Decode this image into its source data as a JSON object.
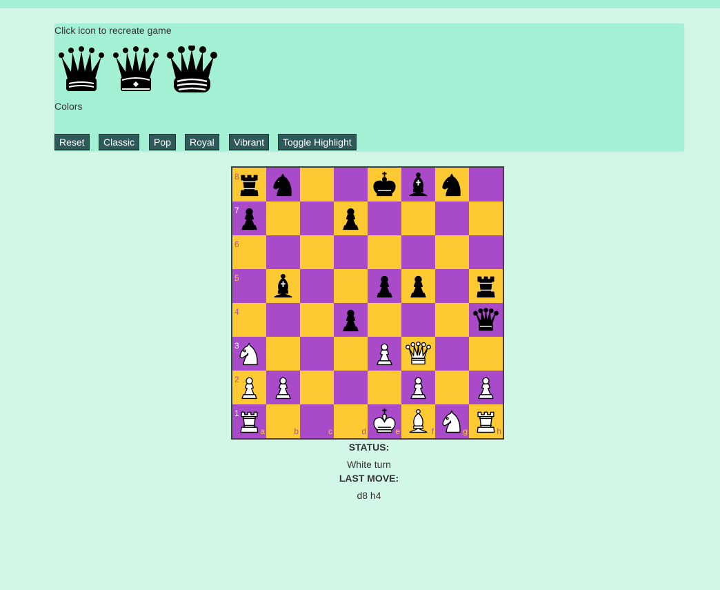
{
  "panel": {
    "title": "Click icon to recreate game",
    "colors_label": "Colors",
    "icons": [
      "queen-icon",
      "queen-icon",
      "queen-icon"
    ],
    "buttons": [
      "Reset",
      "Classic",
      "Pop",
      "Royal",
      "Vibrant",
      "Toggle Highlight"
    ]
  },
  "board": {
    "light_color": "#ffc933",
    "dark_color": "#a94ac9",
    "files": [
      "a",
      "b",
      "c",
      "d",
      "e",
      "f",
      "g",
      "h"
    ],
    "ranks": [
      "8",
      "7",
      "6",
      "5",
      "4",
      "3",
      "2",
      "1"
    ],
    "position": [
      [
        "r",
        "n",
        "",
        "",
        "k",
        "b",
        "n",
        ""
      ],
      [
        "p",
        "",
        "",
        "p",
        "",
        "",
        "",
        ""
      ],
      [
        "",
        "",
        "",
        "",
        "",
        "",
        "",
        ""
      ],
      [
        "",
        "b",
        "",
        "",
        "p",
        "p",
        "",
        "r"
      ],
      [
        "",
        "",
        "",
        "p",
        "",
        "",
        "",
        "q"
      ],
      [
        "N",
        "",
        "",
        "",
        "P",
        "Q",
        "",
        ""
      ],
      [
        "P",
        "P",
        "",
        "",
        "",
        "P",
        "",
        "P"
      ],
      [
        "R",
        "",
        "",
        "",
        "K",
        "B",
        "N",
        "R"
      ]
    ]
  },
  "status": {
    "status_label": "STATUS:",
    "status_value": "White turn",
    "last_move_label": "LAST MOVE:",
    "last_move_value": "d8 h4"
  }
}
